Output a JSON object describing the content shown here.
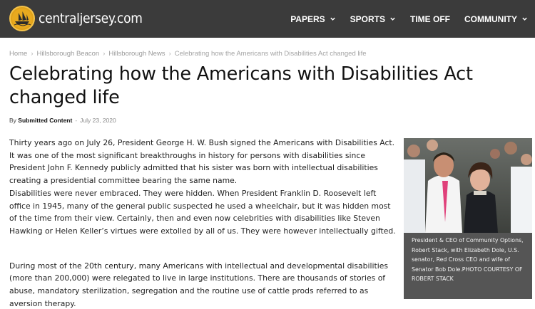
{
  "header": {
    "site_name": "centraljersey.com",
    "nav": [
      {
        "label": "PAPERS",
        "has_dropdown": true
      },
      {
        "label": "SPORTS",
        "has_dropdown": true
      },
      {
        "label": "TIME OFF",
        "has_dropdown": false
      },
      {
        "label": "COMMUNITY",
        "has_dropdown": true
      }
    ],
    "colors": {
      "bar": "#3b3b3b",
      "logo_accent": "#e0a21a"
    }
  },
  "breadcrumb": {
    "items": [
      "Home",
      "Hillsborough Beacon",
      "Hillsborough News"
    ],
    "current": "Celebrating how the Americans with Disabilities Act changed life",
    "separator": "›"
  },
  "article": {
    "title": "Celebrating how the Americans with Disabilities Act changed life",
    "by_label": "By",
    "author": "Submitted Content",
    "date_separator": "-",
    "date": "July 23, 2020",
    "paragraphs": [
      "Thirty years ago on July 26, President George H. W. Bush signed the Americans with Disabilities Act. It was one of the most significant breakthroughs in history for persons with disabilities since President John F. Kennedy publicly admitted that his sister was born with intellectual disabilities creating a presidential committee bearing the same name.",
      "Disabilities were never embraced. They were hidden. When President Franklin D. Roosevelt left office in 1945, many of the general public suspected he used a wheelchair, but it was hidden most of the time from their view. Certainly, then and even now celebrities with disabilities like Steven Hawking or Helen Keller’s virtues were extolled by all of us. They were however intellectually gifted.",
      "During most of the 20th century, many Americans with intellectual and developmental disabilities (more than 200,000) were relegated to live in large institutions. There are thousands of stories of abuse, mandatory sterilization, segregation and the routine use of cattle prods referred to as aversion therapy."
    ],
    "figure": {
      "caption": "President & CEO of Community Options, Robert Stack, with Elizabeth Dole, U.S. senator, Red Cross CEO and wife of Senator Bob Dole.PHOTO COURTESY OF ROBERT STACK"
    }
  }
}
